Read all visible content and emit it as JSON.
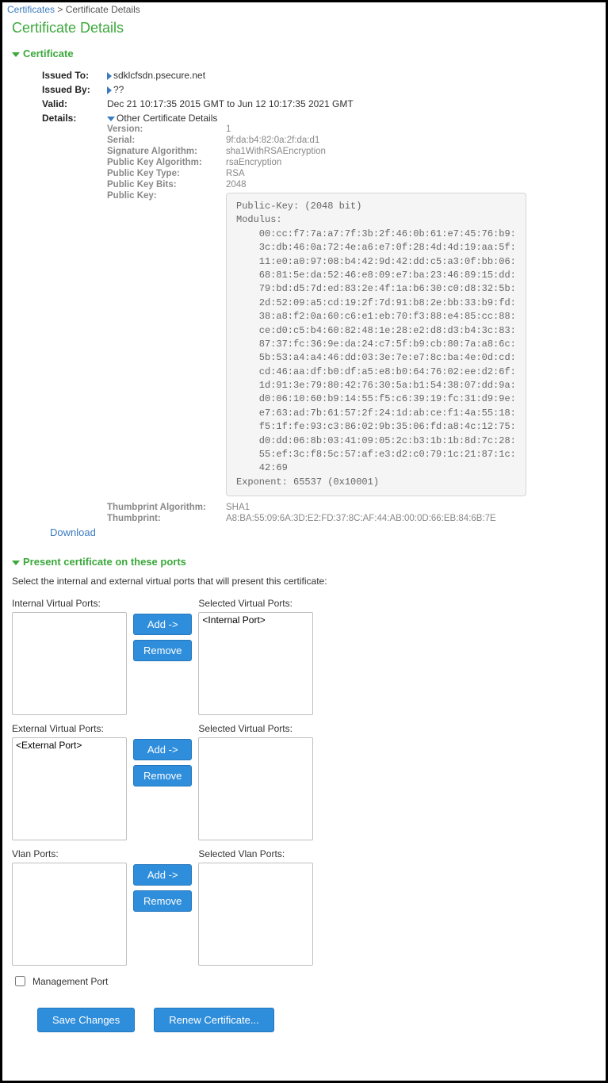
{
  "breadcrumb": {
    "parent": "Certificates",
    "sep": " > ",
    "current": "Certificate Details"
  },
  "page_title": "Certificate Details",
  "sections": {
    "certificate": "Certificate",
    "ports": "Present certificate on these ports"
  },
  "cert": {
    "issued_to_label": "Issued To:",
    "issued_to": "sdklcfsdn.psecure.net",
    "issued_by_label": "Issued By:",
    "issued_by": "??",
    "valid_label": "Valid:",
    "valid": "Dec 21 10:17:35 2015 GMT to Jun 12 10:17:35 2021 GMT",
    "details_label": "Details:",
    "details_toggle": "Other Certificate Details",
    "details": {
      "version_label": "Version:",
      "version": "1",
      "serial_label": "Serial:",
      "serial": "9f:da:b4:82:0a:2f:da:d1",
      "sigalg_label": "Signature Algorithm:",
      "sigalg": "sha1WithRSAEncryption",
      "pkalg_label": "Public Key Algorithm:",
      "pkalg": "rsaEncryption",
      "pktype_label": "Public Key Type:",
      "pktype": "RSA",
      "pkbits_label": "Public Key Bits:",
      "pkbits": "2048",
      "pk_label": "Public Key:",
      "pk_text": "Public-Key: (2048 bit)\nModulus:\n    00:cc:f7:7a:a7:7f:3b:2f:46:0b:61:e7:45:76:b9:\n    3c:db:46:0a:72:4e:a6:e7:0f:28:4d:4d:19:aa:5f:\n    11:e0:a0:97:08:b4:42:9d:42:dd:c5:a3:0f:bb:06:\n    68:81:5e:da:52:46:e8:09:e7:ba:23:46:89:15:dd:\n    79:bd:d5:7d:ed:83:2e:4f:1a:b6:30:c0:d8:32:5b:\n    2d:52:09:a5:cd:19:2f:7d:91:b8:2e:bb:33:b9:fd:\n    38:a8:f2:0a:60:c6:e1:eb:70:f3:88:e4:85:cc:88:\n    ce:d0:c5:b4:60:82:48:1e:28:e2:d8:d3:b4:3c:83:\n    87:37:fc:36:9e:da:24:c7:5f:b9:cb:80:7a:a8:6c:\n    5b:53:a4:a4:46:dd:03:3e:7e:e7:8c:ba:4e:0d:cd:\n    cd:46:aa:df:b0:df:a5:e8:b0:64:76:02:ee:d2:6f:\n    1d:91:3e:79:80:42:76:30:5a:b1:54:38:07:dd:9a:\n    d0:06:10:60:b9:14:55:f5:c6:39:19:fc:31:d9:9e:\n    e7:63:ad:7b:61:57:2f:24:1d:ab:ce:f1:4a:55:18:\n    f5:1f:fe:93:c3:86:02:9b:35:06:fd:a8:4c:12:75:\n    d0:dd:06:8b:03:41:09:05:2c:b3:1b:1b:8d:7c:28:\n    55:ef:3c:f8:5c:57:af:e3:d2:c0:79:1c:21:87:1c:\n    42:69\nExponent: 65537 (0x10001)",
      "thumbalg_label": "Thumbprint Algorithm:",
      "thumbalg": "SHA1",
      "thumb_label": "Thumbprint:",
      "thumb": "A8:BA:55:09:6A:3D:E2:FD:37:8C:AF:44:AB:00:0D:66:EB:84:6B:7E"
    },
    "download": "Download"
  },
  "ports": {
    "intro": "Select the internal and external virtual ports that will present this certificate:",
    "internal_label": "Internal Virtual Ports:",
    "selected_internal_label": "Selected Virtual Ports:",
    "external_label": "External Virtual Ports:",
    "selected_external_label": "Selected Virtual Ports:",
    "vlan_label": "Vlan Ports:",
    "selected_vlan_label": "Selected Vlan Ports:",
    "internal_options": [],
    "selected_internal": [
      "<Internal Port>"
    ],
    "external_options": [
      "<External Port>"
    ],
    "selected_external": [],
    "vlan_options": [],
    "selected_vlan": [],
    "add_label": "Add ->",
    "remove_label": "Remove",
    "mgmt_label": "Management Port"
  },
  "actions": {
    "save": "Save Changes",
    "renew": "Renew Certificate..."
  }
}
